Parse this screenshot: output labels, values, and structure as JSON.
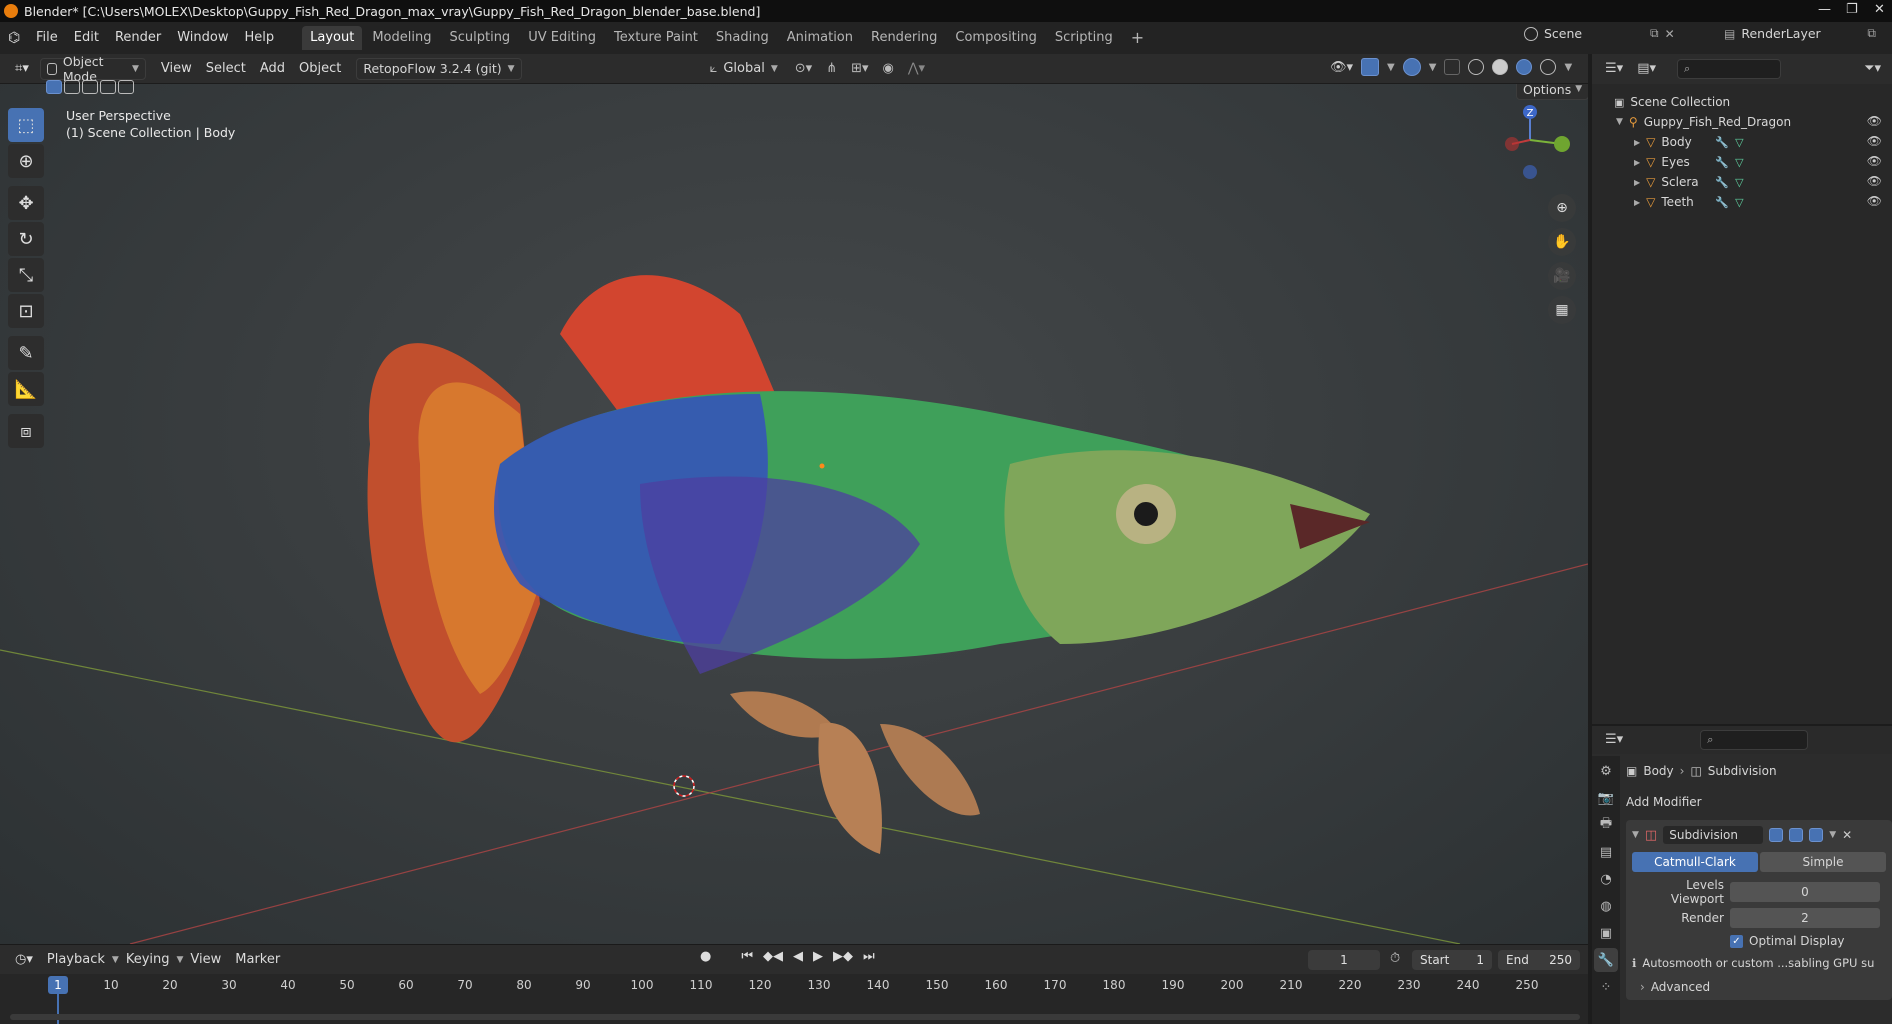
{
  "titlebar": {
    "title": "Blender* [C:\\Users\\MOLEX\\Desktop\\Guppy_Fish_Red_Dragon_max_vray\\Guppy_Fish_Red_Dragon_blender_base.blend]"
  },
  "menu": {
    "items": [
      "File",
      "Edit",
      "Render",
      "Window",
      "Help"
    ]
  },
  "workspaces": [
    "Layout",
    "Modeling",
    "Sculpting",
    "UV Editing",
    "Texture Paint",
    "Shading",
    "Animation",
    "Rendering",
    "Compositing",
    "Scripting"
  ],
  "scene": {
    "name": "Scene",
    "render_layer": "RenderLayer"
  },
  "viewport_header": {
    "mode": "Object Mode",
    "menus": [
      "View",
      "Select",
      "Add",
      "Object"
    ],
    "addon": "RetopoFlow 3.2.4 (git)",
    "orientation": "Global",
    "options": "Options"
  },
  "viewport": {
    "perspective": "User Perspective",
    "collection": "(1) Scene Collection | Body"
  },
  "gizmo": {
    "z": "Z"
  },
  "timeline": {
    "menus": [
      "Playback",
      "Keying",
      "View",
      "Marker"
    ],
    "current_frame": "1",
    "start_label": "Start",
    "start": "1",
    "end_label": "End",
    "end": "250",
    "ticks": [
      "1",
      "10",
      "20",
      "30",
      "40",
      "50",
      "60",
      "70",
      "80",
      "90",
      "100",
      "110",
      "120",
      "130",
      "140",
      "150",
      "160",
      "170",
      "180",
      "190",
      "200",
      "210",
      "220",
      "230",
      "240",
      "250"
    ]
  },
  "outliner": {
    "root": "Scene Collection",
    "collection": "Guppy_Fish_Red_Dragon",
    "objects": [
      "Body",
      "Eyes",
      "Sclera",
      "Teeth"
    ]
  },
  "properties": {
    "breadcrumb_object": "Body",
    "breadcrumb_modifier": "Subdivision",
    "add_modifier": "Add Modifier",
    "modifier_name": "Subdivision",
    "type_a": "Catmull-Clark",
    "type_b": "Simple",
    "levels_viewport_label": "Levels Viewport",
    "levels_viewport": "0",
    "render_label": "Render",
    "render": "2",
    "optimal_display": "Optimal Display",
    "warning": "Autosmooth or custom ...sabling GPU subdivisi",
    "advanced": "Advanced"
  },
  "colors": {
    "accent": "#4772b3",
    "panel": "#2c2c2c",
    "logo": "#e87d0d"
  }
}
